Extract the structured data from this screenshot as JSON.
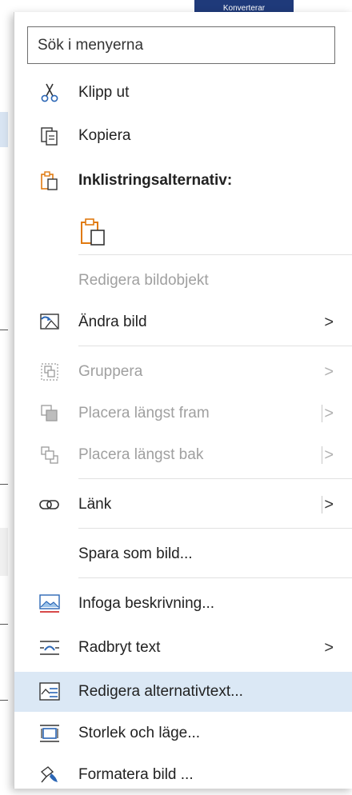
{
  "background": {
    "banner_text": "Konverterar"
  },
  "search": {
    "placeholder": "Sök i menyerna"
  },
  "menu": {
    "cut": {
      "label": "Klipp ut",
      "icon": "scissors-icon"
    },
    "copy": {
      "label": "Kopiera",
      "icon": "copy-icon"
    },
    "paste_options": {
      "label": "Inklistringsalternativ:",
      "icon": "clipboard-icon"
    },
    "edit_picture_object": {
      "label": "Redigera bildobjekt"
    },
    "change_picture": {
      "label": "Ändra bild",
      "icon": "change-picture-icon",
      "chevron": ">"
    },
    "group": {
      "label": "Gruppera",
      "icon": "group-icon",
      "chevron": ">"
    },
    "bring_to_front": {
      "label": "Placera längst fram",
      "icon": "bring-front-icon",
      "chevron": ">"
    },
    "send_to_back": {
      "label": "Placera längst bak",
      "icon": "send-back-icon",
      "chevron": ">"
    },
    "link": {
      "label": "Länk",
      "icon": "link-icon",
      "chevron": ">"
    },
    "save_as_picture": {
      "label": "Spara som bild..."
    },
    "insert_caption": {
      "label": "Infoga beskrivning...",
      "icon": "caption-icon"
    },
    "wrap_text": {
      "label": "Radbryt text",
      "icon": "wrap-text-icon",
      "chevron": ">"
    },
    "edit_alt_text": {
      "label": "Redigera alternativtext...",
      "icon": "alt-text-icon"
    },
    "size_position": {
      "label": "Storlek och läge...",
      "icon": "size-position-icon"
    },
    "format_picture": {
      "label": "Formatera bild ...",
      "icon": "format-picture-icon"
    }
  },
  "colors": {
    "accent_orange": "#e07a10",
    "accent_blue": "#2b66b5",
    "highlight": "#dbe8f5"
  }
}
